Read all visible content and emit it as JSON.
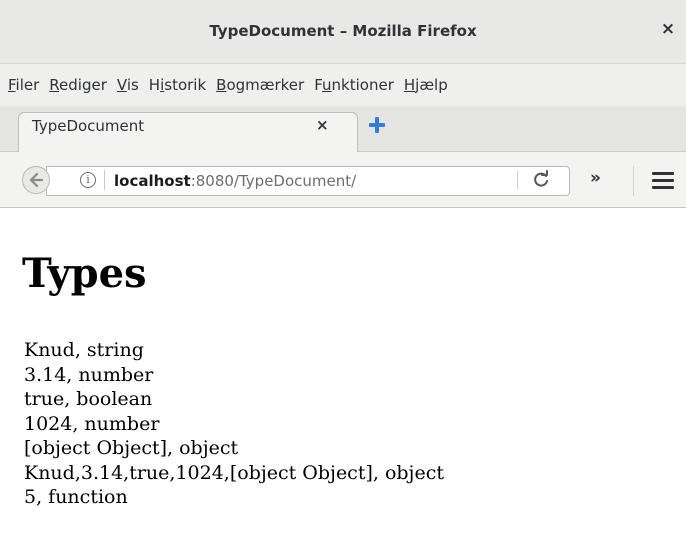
{
  "window": {
    "title": "TypeDocument – Mozilla Firefox",
    "close_glyph": "×"
  },
  "menubar": {
    "items": [
      {
        "accel": "F",
        "rest": "iler"
      },
      {
        "accel": "R",
        "rest": "ediger"
      },
      {
        "accel": "V",
        "rest": "is"
      },
      {
        "pre": "H",
        "accel": "i",
        "rest": "storik"
      },
      {
        "accel": "B",
        "rest": "ogmærker"
      },
      {
        "pre": "F",
        "accel": "u",
        "rest": "nktioner"
      },
      {
        "accel": "H",
        "rest": "jælp"
      }
    ]
  },
  "tabs": {
    "active_label": "TypeDocument",
    "close_glyph": "×"
  },
  "navbar": {
    "url_host": "localhost",
    "url_rest": ":8080/TypeDocument/",
    "overflow_glyph": "»",
    "info_glyph": "i"
  },
  "page": {
    "heading": "Types",
    "lines": [
      "Knud, string",
      "3.14, number",
      "true, boolean",
      "1024, number",
      "[object Object], object",
      "Knud,3.14,true,1024,[object Object], object",
      "5, function"
    ]
  },
  "icons": {
    "back": "arrow-left-icon",
    "info": "info-icon",
    "reload": "reload-icon",
    "menu": "hamburger-menu-icon",
    "new_tab": "plus-icon"
  },
  "colors": {
    "titlebar_bg": "#e8e8e7",
    "menubar_bg": "#efefed",
    "tabbar_bg": "#e4e4e2",
    "new_tab_blue": "#3a7bd5",
    "url_host": "#1b1b1b",
    "url_rest": "#6d6d6d"
  }
}
